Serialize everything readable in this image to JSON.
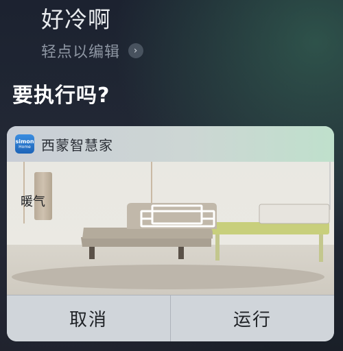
{
  "siri": {
    "utterance": "好冷啊",
    "edit_hint": "轻点以编辑",
    "question": "要执行吗?"
  },
  "card": {
    "app_icon_text_top": "simon",
    "app_icon_text_bottom": "Home",
    "app_name": "西蒙智慧家",
    "tile_label": "暖气",
    "cancel_label": "取消",
    "run_label": "运行"
  },
  "icons": {
    "edit_chevron": "chevron-right-icon",
    "heater": "heater-icon"
  },
  "colors": {
    "app_icon": "#2a7ad0",
    "card_bg": "#cdd4da"
  }
}
